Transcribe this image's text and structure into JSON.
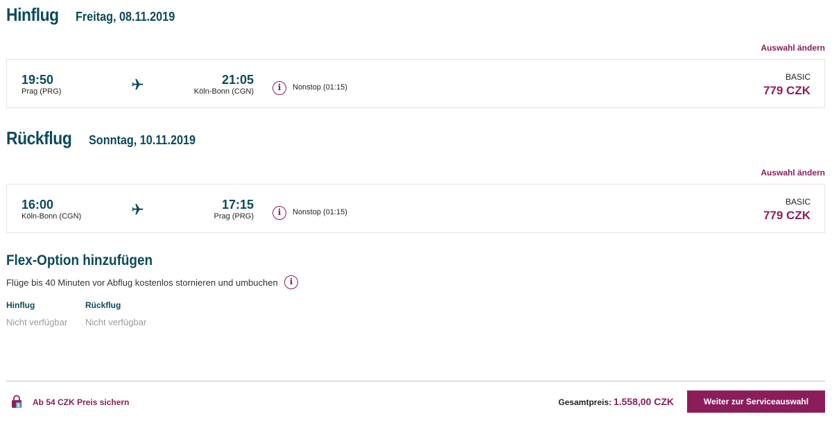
{
  "outbound": {
    "title": "Hinflug",
    "date": "Freitag, 08.11.2019",
    "change_link": "Auswahl ändern",
    "departure_time": "19:50",
    "departure_city": "Prag (PRG)",
    "arrival_time": "21:05",
    "arrival_city": "Köln-Bonn (CGN)",
    "stops": "Nonstop (01:15)",
    "fare_class": "BASIC",
    "price": "779 CZK"
  },
  "return": {
    "title": "Rückflug",
    "date": "Sonntag, 10.11.2019",
    "change_link": "Auswahl ändern",
    "departure_time": "16:00",
    "departure_city": "Köln-Bonn (CGN)",
    "arrival_time": "17:15",
    "arrival_city": "Prag (PRG)",
    "stops": "Nonstop (01:15)",
    "fare_class": "BASIC",
    "price": "779 CZK"
  },
  "flex": {
    "title": "Flex-Option hinzufügen",
    "description": "Flüge bis 40 Minuten vor Abflug kostenlos stornieren und umbuchen",
    "columns": [
      {
        "heading": "Hinflug",
        "value": "Nicht verfügbar"
      },
      {
        "heading": "Rückflug",
        "value": "Nicht verfügbar"
      }
    ]
  },
  "footer": {
    "lock_text": "Ab 54 CZK Preis sichern",
    "total_label": "Gesamtpreis:",
    "total_value": "1.558,00 CZK",
    "continue_label": "Weiter zur Serviceauswahl"
  },
  "icons": {
    "info": "info-icon",
    "plane": "airplane-icon",
    "lock": "price-lock-icon"
  },
  "colors": {
    "primary": "#0b4a5a",
    "accent": "#8b1d5b",
    "muted": "#9a9a9a"
  }
}
